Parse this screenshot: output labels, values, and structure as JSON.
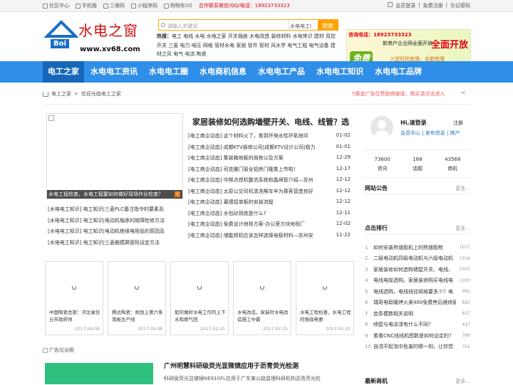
{
  "topbar": {
    "left": [
      "社区中心",
      "手机版",
      "二维码",
      "小程序码",
      "购物车(0)"
    ],
    "hotline": "合作联系微信/QQ/电话：18923733323",
    "right": [
      "会员登录",
      "免费注册",
      "忘记密码"
    ]
  },
  "logo": {
    "text": "水电之窗",
    "domain": "www.xv68.com",
    "badge": "Boi"
  },
  "search": {
    "placeholder": "请输入关键词",
    "select": "水电电工l",
    "button": "搜索"
  },
  "hotwords": {
    "label": "热搜：",
    "words": "电工 电线 水电 水电之家 开关插座 水电改造 装修材料 水电常识 建材 双控开关 三菱 电力 电压 网格 管材水电 家居 管件 管材 风水学 电气工程 电气设备 建材之风 电气 电流 陶瓷"
  },
  "ad": {
    "phone": "咨询电话：18923733323",
    "big": "全面开放",
    "mid": "新商户企业网全面开放",
    "free": "免费",
    "sub": "入驻时间有限，名额有限",
    "pages": [
      "1",
      "2"
    ]
  },
  "nav": [
    "电工之家",
    "水电电工资讯",
    "水电电工圈",
    "水电商机信息",
    "水电电工产品",
    "水电电工知识",
    "水电电工品牌"
  ],
  "breadcrumb": {
    "home": "电工之家",
    "sep": ">",
    "current": "欢迎光临电工之家",
    "notice": "5黄金广告位赞助商链接，购买请点击进入"
  },
  "featured": {
    "caption": "水电工程检查，水电工程要如何做好现场作业检查？",
    "num": "1"
  },
  "headline": "家居装修如何选购墙壁开关、电线、线管？选",
  "news": [
    {
      "t": "[电工商企动态] 这个材料火了，看到环保水性环氧地坪",
      "d": "01-02"
    },
    {
      "t": "[电工商企动态] 成都KTV装修公司|成都KTV设计公司|极力",
      "d": "01-01"
    },
    {
      "t": "[电工商企动态] 集装箱地板的局势以及方案",
      "d": "12-29"
    },
    {
      "t": "[电工商企动态] 司克雅门窗全铝房门隆重上市啦！",
      "d": "12-17"
    },
    {
      "t": "[电工商企动态] 中频点焊机整流系统和晶闸管介绍—苏州",
      "d": "12-12"
    },
    {
      "t": "[电工商企动态] 太原公交司机清洗喉车辛为乘客营造良好",
      "d": "12-12"
    },
    {
      "t": "[电工商企动态] 幕墙铝单板的安装流程",
      "d": "12-12"
    },
    {
      "t": "[电工商企动态] 水包砂到底是什么?",
      "d": "12-11"
    },
    {
      "t": "[电工商企动态] 免费设计地毯方案-办公室方块地毯厂",
      "d": "12-02"
    },
    {
      "t": "[电工商企动态] 储能焊机应该怎样选择电极材料—苏州安",
      "d": "11-22"
    }
  ],
  "knowledge": [
    "[水电电工知识] 电工知识|三菱PLC基注指令的要素及",
    "[水电电工知识] 电工知识|电动机轴承的故障检修方法",
    "[水电电工知识] 电工知识|电动机绝缘电阻低的原因及",
    "[水电电工知识] 电工知识|三菱触摸屏密码设定方法"
  ],
  "cards": [
    {
      "t": "中国陶瓷总部：河北省任丘市政府领",
      "d": "2017-09-08"
    },
    {
      "t": "腾达陶瓷：规划上第六条落板生产线",
      "d": "2017-09-08"
    },
    {
      "t": "如何做好水电工作的上下水和燃气回",
      "d": "2017-02-25"
    },
    {
      "t": "水电改造，家装时水电改造施工中最",
      "d": "2017-02-25"
    },
    {
      "t": "水电工程检查，水电工程的强弱电要",
      "d": "2017-02-25"
    }
  ],
  "adpos": "广告位出租",
  "article": {
    "title": "广州明慧科研级荧光显微镜应用于沥青荧光检测",
    "text": "科研级荧光显微镜NE910FL应用于广东某公路监理科研机构沥青荧光检"
  },
  "login": {
    "hi": "Hi,请登录",
    "reg": "注册",
    "links": "会员中心 | 发布信息 | 商户"
  },
  "stats": [
    {
      "n": "73600",
      "l": "资讯"
    },
    {
      "n": "168",
      "l": "话题"
    },
    {
      "n": "43568",
      "l": "商机"
    }
  ],
  "notice_title": "网站公告",
  "rank_title": "点击排行",
  "more": "更多...",
  "rank": [
    {
      "n": "1",
      "t": "如何安装热熔胶机上的热熔胶枪",
      "c": "1017"
    },
    {
      "n": "2",
      "t": "二级电动机四级电动机与六级电动机",
      "c": "1016"
    },
    {
      "n": "3",
      "t": "家居装修如何选购墙壁开关、电线、",
      "c": "1003"
    },
    {
      "n": "4",
      "t": "电线电缆选购。家居装修购买电线电",
      "c": "1003"
    },
    {
      "n": "5",
      "t": "电线选购，电线线径规格要多少？电",
      "c": "962"
    },
    {
      "n": "6",
      "t": "瑞奇电取暖烤火桌400免费售后维修服",
      "c": "882"
    },
    {
      "n": "7",
      "t": "齿条模数相关说明",
      "c": "817"
    },
    {
      "n": "8",
      "t": "喷壁与电涂漆有什么不同？",
      "c": "417"
    },
    {
      "n": "9",
      "t": "看看CNC线线机图数是如何设定的？",
      "c": "399"
    },
    {
      "n": "10",
      "t": "自流平起泡中危害的哪一刻，让你觉",
      "c": "352"
    }
  ],
  "new_biz_title": "最新商机"
}
